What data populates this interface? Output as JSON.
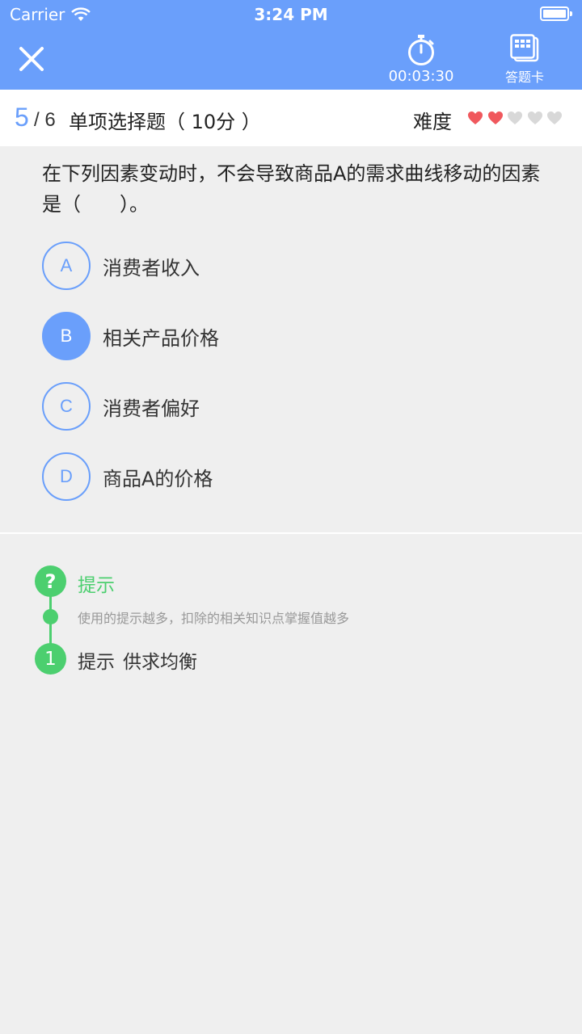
{
  "status": {
    "carrier": "Carrier",
    "time": "3:24 PM"
  },
  "toolbar": {
    "timer": "00:03:30",
    "card_label": "答题卡"
  },
  "progress": {
    "current": "5",
    "total": "/ 6"
  },
  "question_type": "单项选择题（ 10分 ）",
  "difficulty": {
    "label": "难度",
    "level": 2,
    "max": 5
  },
  "question": {
    "text": "在下列因素变动时，不会导致商品A的需求曲线移动的因素是（　　）。"
  },
  "options": [
    {
      "letter": "A",
      "text": "消费者收入",
      "selected": false
    },
    {
      "letter": "B",
      "text": "相关产品价格",
      "selected": true
    },
    {
      "letter": "C",
      "text": "消费者偏好",
      "selected": false
    },
    {
      "letter": "D",
      "text": "商品A的价格",
      "selected": false
    }
  ],
  "hint": {
    "icon_char": "?",
    "title": "提示",
    "note": "使用的提示越多，扣除的相关知识点掌握值越多",
    "items": [
      {
        "number": "1",
        "label": "提示",
        "content": "供求均衡"
      }
    ]
  },
  "colors": {
    "primary": "#6a9ffb",
    "accent_green": "#4ccf6f",
    "heart_on": "#f0585d",
    "heart_off": "#d8d8d8"
  }
}
